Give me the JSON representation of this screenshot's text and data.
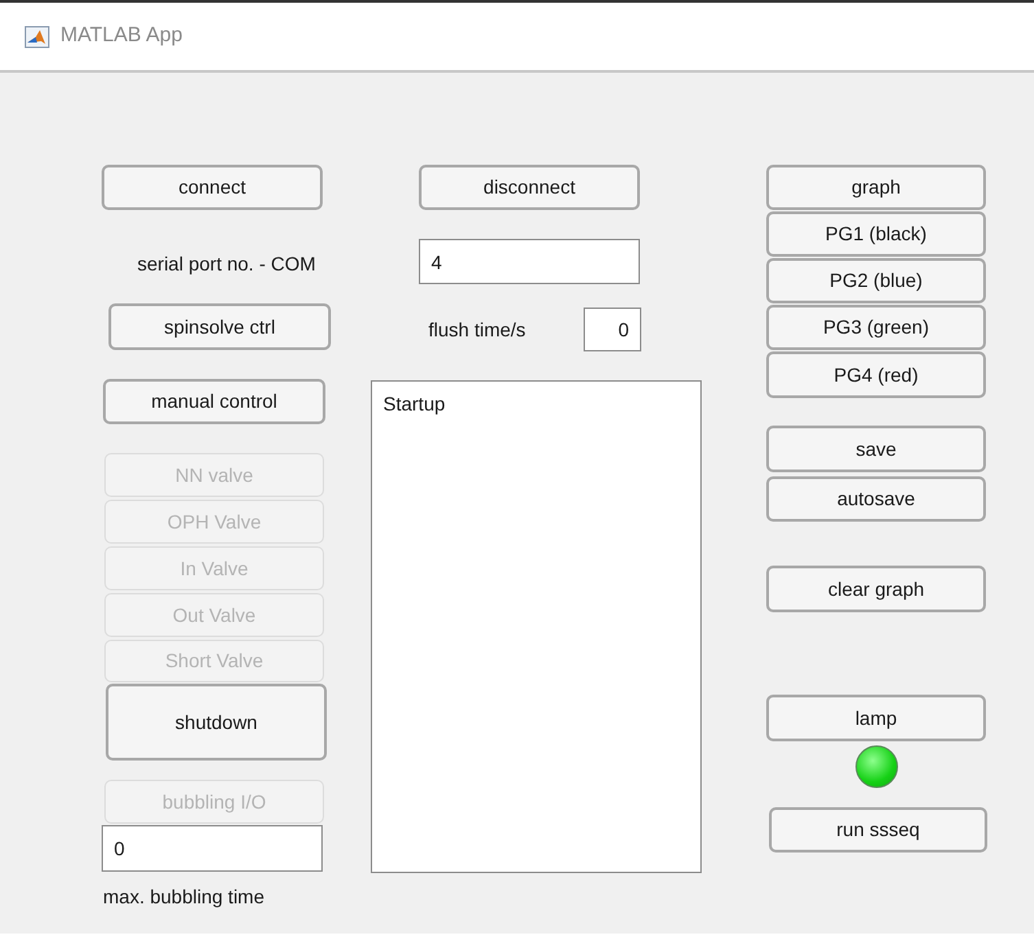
{
  "window": {
    "title": "MATLAB App"
  },
  "controls": [
    {
      "kind": "button",
      "label": "connect",
      "disabled": false
    },
    {
      "kind": "label",
      "text": "serial port no. - COM"
    },
    {
      "kind": "button",
      "label": "spinsolve ctrl",
      "disabled": false
    },
    {
      "kind": "button",
      "label": "manual control",
      "disabled": false
    },
    {
      "kind": "button",
      "label": "NN valve",
      "disabled": true
    },
    {
      "kind": "button",
      "label": "OPH Valve",
      "disabled": true
    },
    {
      "kind": "button",
      "label": "In Valve",
      "disabled": true
    },
    {
      "kind": "button",
      "label": "Out Valve",
      "disabled": true
    },
    {
      "kind": "button",
      "label": "Short Valve",
      "disabled": true
    },
    {
      "kind": "button",
      "label": "shutdown",
      "disabled": false
    },
    {
      "kind": "button",
      "label": "bubbling I/O",
      "disabled": true
    },
    {
      "kind": "field",
      "value": "0",
      "right_aligned": false
    },
    {
      "kind": "label",
      "text": "max. bubbling time"
    },
    {
      "kind": "button",
      "label": "disconnect",
      "disabled": false
    },
    {
      "kind": "field",
      "value": "4",
      "right_aligned": false
    },
    {
      "kind": "label",
      "text": "flush time/s"
    },
    {
      "kind": "field",
      "value": "0",
      "right_aligned": true
    },
    {
      "kind": "listbox",
      "items": [
        "Startup"
      ]
    },
    {
      "kind": "button",
      "label": "graph",
      "disabled": false
    },
    {
      "kind": "button",
      "label": "PG1 (black)",
      "disabled": false
    },
    {
      "kind": "button",
      "label": "PG2 (blue)",
      "disabled": false
    },
    {
      "kind": "button",
      "label": "PG3 (green)",
      "disabled": false
    },
    {
      "kind": "button",
      "label": "PG4 (red)",
      "disabled": false
    },
    {
      "kind": "button",
      "label": "save",
      "disabled": false
    },
    {
      "kind": "button",
      "label": "autosave",
      "disabled": false
    },
    {
      "kind": "button",
      "label": "clear graph",
      "disabled": false
    },
    {
      "kind": "button",
      "label": "lamp",
      "disabled": false
    },
    {
      "kind": "lamp",
      "on": true
    },
    {
      "kind": "button",
      "label": "run ssseq",
      "disabled": false
    }
  ]
}
